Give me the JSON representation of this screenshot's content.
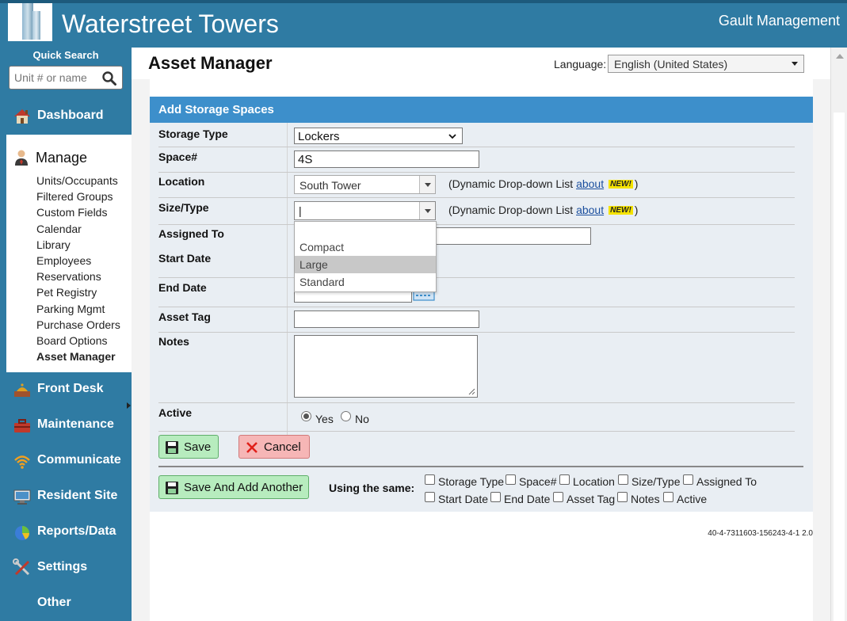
{
  "header": {
    "site_title": "Waterstreet Towers",
    "management": "Gault Management"
  },
  "sidebar": {
    "quick_search_label": "Quick Search",
    "quick_search_placeholder": "Unit # or name",
    "items": [
      {
        "label": "Dashboard",
        "icon": "house-icon"
      },
      {
        "label": "Manage",
        "icon": "person-icon"
      },
      {
        "label": "Front Desk",
        "icon": "desk-bell-icon"
      },
      {
        "label": "Maintenance",
        "icon": "toolbox-icon"
      },
      {
        "label": "Communicate",
        "icon": "wifi-icon"
      },
      {
        "label": "Resident Site",
        "icon": "monitor-icon"
      },
      {
        "label": "Reports/Data",
        "icon": "pie-chart-icon"
      },
      {
        "label": "Settings",
        "icon": "tools-icon"
      },
      {
        "label": "Other",
        "icon": ""
      }
    ],
    "manage_sub": [
      "Units/Occupants",
      "Filtered Groups",
      "Custom Fields",
      "Calendar",
      "Library",
      "Employees",
      "Reservations",
      "Pet Registry",
      "Parking Mgmt",
      "Purchase Orders",
      "Board Options",
      "Asset Manager"
    ]
  },
  "page": {
    "title": "Asset Manager",
    "language_label": "Language:",
    "language_value": "English (United States)"
  },
  "form": {
    "header": "Add Storage Spaces",
    "labels": {
      "storage_type": "Storage Type",
      "space": "Space#",
      "location": "Location",
      "size_type": "Size/Type",
      "assigned_to": "Assigned To",
      "start_date": "Start Date",
      "end_date": "End Date",
      "asset_tag": "Asset Tag",
      "notes": "Notes",
      "active": "Active"
    },
    "values": {
      "storage_type": "Lockers",
      "space": "4S",
      "location": "South Tower",
      "size_type": "",
      "assigned_to": "",
      "start_date": "",
      "end_date": "",
      "asset_tag": "",
      "notes": ""
    },
    "dynamic_hint": "(Dynamic Drop-down List",
    "about_link": "about",
    "new_badge": "NEW!",
    "hint_close": ")",
    "size_options": [
      "",
      "Compact",
      "Large",
      "Standard"
    ],
    "size_highlighted": "Large",
    "active_yes": "Yes",
    "active_no": "No",
    "active_selected": "Yes",
    "save": "Save",
    "cancel": "Cancel",
    "save_add_another": "Save And Add Another",
    "using_same": "Using the same:",
    "using_same_options": [
      "Storage Type",
      "Space#",
      "Location",
      "Size/Type",
      "Assigned To",
      "Start Date",
      "End Date",
      "Asset Tag",
      "Notes",
      "Active"
    ]
  },
  "footer_code": "40-4-7311603-156243-4-1 2.0",
  "colors": {
    "brand_blue": "#2f7ba3",
    "form_header": "#3d8fcb",
    "form_bg": "#e9eef3",
    "save_green": "#b7ecbe",
    "cancel_red": "#f6b6b6",
    "new_badge": "#f5e300"
  }
}
